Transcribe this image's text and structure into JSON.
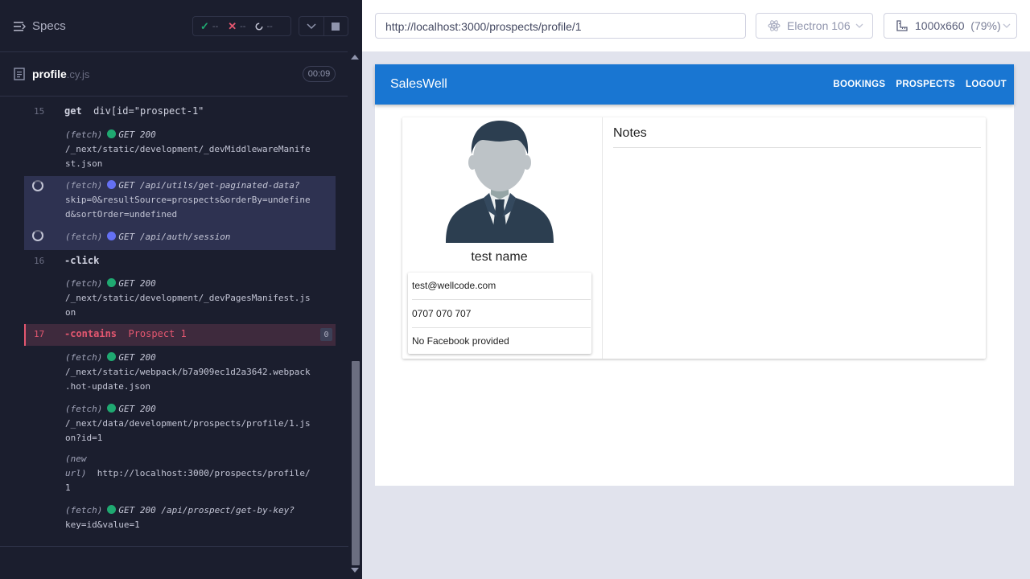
{
  "runner": {
    "specs_label": "Specs",
    "stats": {
      "passed": "--",
      "failed": "--",
      "pending": "--"
    },
    "file": {
      "name": "profile",
      "ext": ".cy.js",
      "duration": "00:09"
    }
  },
  "log": [
    {
      "type": "cmd",
      "num": "15",
      "name": "get",
      "arg": "div[id=\"prospect-1\""
    },
    {
      "type": "fetch",
      "prefix": "(fetch)",
      "status": "green",
      "method": "GET 200",
      "lines": [
        "/_next/static/development/_devMiddlewareManife",
        "st.json"
      ]
    },
    {
      "type": "fetch",
      "prefix": "(fetch)",
      "status": "blue",
      "method": "GET /api/utils/get-paginated-data?",
      "lines": [
        "skip=0&resultSource=prospects&orderBy=undefine",
        "d&sortOrder=undefined"
      ]
    },
    {
      "type": "fetch",
      "prefix": "(fetch)",
      "status": "blue",
      "method": "GET /api/auth/session",
      "lines": []
    },
    {
      "type": "cmd",
      "num": "16",
      "name": "-click",
      "arg": ""
    },
    {
      "type": "fetch",
      "prefix": "(fetch)",
      "status": "green",
      "method": "GET 200",
      "lines": [
        "/_next/static/development/_devPagesManifest.js",
        "on"
      ]
    },
    {
      "type": "cmd",
      "num": "17",
      "name": "-contains",
      "arg": "Prospect 1",
      "count": "0"
    },
    {
      "type": "fetch",
      "prefix": "(fetch)",
      "status": "green",
      "method": "GET 200",
      "lines": [
        "/_next/static/webpack/b7a909ec1d2a3642.webpack",
        ".hot-update.json"
      ]
    },
    {
      "type": "fetch",
      "prefix": "(fetch)",
      "status": "green",
      "method": "GET 200",
      "lines": [
        "/_next/data/development/prospects/profile/1.js",
        "on?id=1"
      ]
    },
    {
      "type": "newurl",
      "prefix": "(new",
      "prefix2": "url)",
      "url": "http://localhost:3000/prospects/profile/",
      "url2": "1"
    },
    {
      "type": "fetch",
      "prefix": "(fetch)",
      "status": "green",
      "method": "GET 200 /api/prospect/get-by-key?",
      "lines": [
        "key=id&value=1"
      ]
    }
  ],
  "browser": {
    "url": "http://localhost:3000/prospects/profile/1",
    "engine": "Electron 106",
    "viewport": "1000x660",
    "zoom": "(79%)"
  },
  "app": {
    "brand": "SalesWell",
    "nav": [
      "BOOKINGS",
      "PROSPECTS",
      "LOGOUT"
    ],
    "profile": {
      "name": "test name",
      "email": "test@wellcode.com",
      "phone": "0707 070 707",
      "facebook": "No Facebook provided"
    },
    "notes_title": "Notes"
  },
  "colors": {
    "runner_bg": "#1b1e2e",
    "pass": "#1fa971",
    "fail": "#e45770",
    "pending_dot": "#6470f3",
    "appbar": "#1976d2"
  }
}
